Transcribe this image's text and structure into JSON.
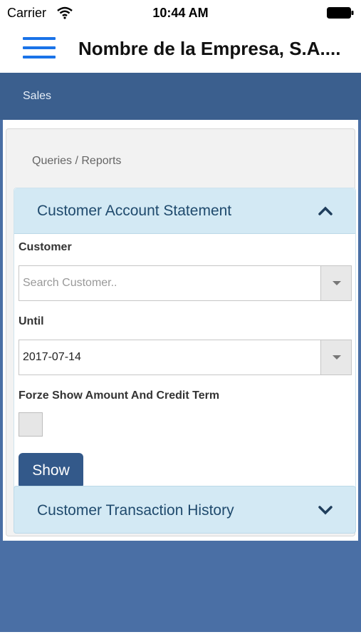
{
  "status_bar": {
    "carrier": "Carrier",
    "time": "10:44 AM"
  },
  "header": {
    "title": "Nombre de la Empresa, S.A...."
  },
  "section": {
    "label": "Sales"
  },
  "breadcrumb": "Queries / Reports",
  "accordion_statement": {
    "title": "Customer Account Statement",
    "customer_label": "Customer",
    "customer_placeholder": "Search Customer..",
    "until_label": "Until",
    "until_value": "2017-07-14",
    "force_label": "Forze Show Amount And Credit Term",
    "show_button": "Show"
  },
  "accordion_history": {
    "title": "Customer Transaction History"
  },
  "colors": {
    "accent": "#1a73e8",
    "section_bar": "#3b5f8e",
    "background_blue": "#4a6fa5",
    "accordion_header": "#d3e9f4",
    "button": "#33598a"
  }
}
